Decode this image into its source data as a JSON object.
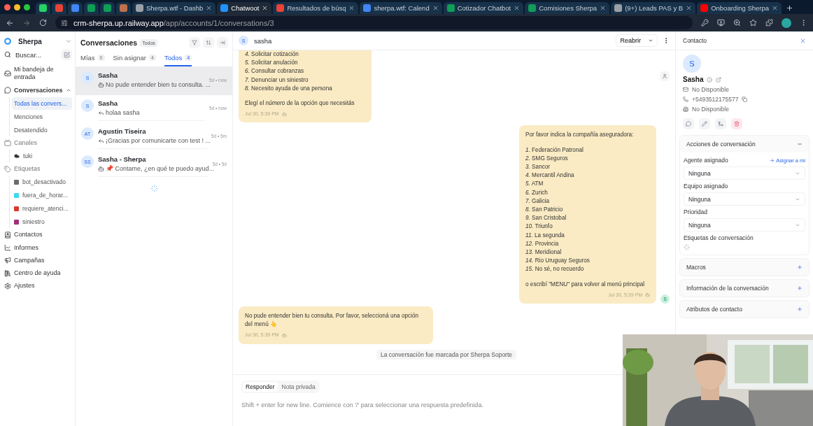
{
  "browser": {
    "tabs": [
      {
        "kind": "pinned",
        "color": "#25d366",
        "selected": false
      },
      {
        "kind": "pinned",
        "color": "#ea4335",
        "selected": false
      },
      {
        "kind": "pinned",
        "color": "#4285f4",
        "selected": false
      },
      {
        "kind": "pinned",
        "color": "#0f9d58",
        "selected": false
      },
      {
        "kind": "pinned",
        "color": "#0f9d58",
        "selected": false
      },
      {
        "kind": "pinned",
        "color": "#c0704a",
        "selected": false
      },
      {
        "kind": "titled",
        "color": "#9aa0a6",
        "label": "Sherpa.wtf - Dashb",
        "selected": false
      },
      {
        "kind": "titled",
        "color": "#1f93ff",
        "label": "Chatwoot",
        "selected": true
      },
      {
        "kind": "titled",
        "color": "#ea4335",
        "label": "Resultados de búsq",
        "selected": false
      },
      {
        "kind": "titled",
        "color": "#4285f4",
        "label": "sherpa.wtf: Calend",
        "selected": false
      },
      {
        "kind": "titled",
        "color": "#0f9d58",
        "label": "Cotizador Chatbot",
        "selected": false
      },
      {
        "kind": "titled",
        "color": "#0f9d58",
        "label": "Comisiones Sherpa",
        "selected": false
      },
      {
        "kind": "titled",
        "color": "#9aa0a6",
        "label": "(9+) Leads PAS y B",
        "selected": false
      },
      {
        "kind": "titled",
        "color": "#ff0000",
        "label": "Onboarding Sherpa",
        "selected": false
      }
    ],
    "url": "**crm-sherpa.up.railway.app**/app/accounts/1/conversations/3"
  },
  "sidebar": {
    "account": "Sherpa",
    "search": {
      "placeholder": "Buscar..."
    },
    "items": [
      {
        "kind": "inbox",
        "label": "Mi bandeja de entrada"
      },
      {
        "kind": "conversations",
        "label": "Conversaciones",
        "expanded": true,
        "children": [
          {
            "label": "Todas las convers...",
            "selected": true
          },
          {
            "label": "Menciones",
            "selected": false
          },
          {
            "label": "Desatendido",
            "selected": false
          }
        ]
      },
      {
        "kind": "channels",
        "label": "Canales",
        "children": [
          {
            "label": "tuki",
            "kind": "channel"
          }
        ]
      },
      {
        "kind": "labels",
        "label": "Etiquetas",
        "children": [
          {
            "label": "bot_desactivado",
            "color": "#6b6b6b"
          },
          {
            "label": "fuera_de_horar...",
            "color": "#3ed8f0"
          },
          {
            "label": "requiere_atenci...",
            "color": "#d93a2b"
          },
          {
            "label": "siniestro",
            "color": "#a0307a"
          }
        ]
      },
      {
        "kind": "contacts",
        "label": "Contactos"
      },
      {
        "kind": "reports",
        "label": "Informes"
      },
      {
        "kind": "campaigns",
        "label": "Campañas"
      },
      {
        "kind": "help",
        "label": "Centro de ayuda"
      },
      {
        "kind": "settings",
        "label": "Ajustes"
      }
    ]
  },
  "conversations": {
    "title": "Conversaciones",
    "filter": "Todos",
    "tabs": [
      {
        "label": "Mías",
        "count": "0",
        "selected": false
      },
      {
        "label": "Sin asignar",
        "count": "4",
        "selected": false
      },
      {
        "label": "Todos",
        "count": "4",
        "selected": true
      }
    ],
    "items": [
      {
        "initials": "S",
        "name": "Sasha",
        "kind": "bot",
        "preview": "No pude entender bien tu consulta. ...",
        "time": "5d • now",
        "selected": true
      },
      {
        "initials": "S",
        "name": "Sasha",
        "kind": "reply",
        "preview": "holaa sasha",
        "time": "5d • now",
        "selected": false
      },
      {
        "initials": "AT",
        "name": "Agustin Tiseira",
        "kind": "reply",
        "preview": "¡Gracias por comunicarte con test ! ...",
        "time": "5d • 5m",
        "selected": false
      },
      {
        "initials": "SS",
        "name": "Sasha - Sherpa",
        "kind": "bot",
        "preview": "📌 Contame, ¿en qué te puedo ayud...",
        "time": "5d • 5d",
        "selected": false
      }
    ]
  },
  "chat": {
    "contact": {
      "initials": "S",
      "name": "sasha"
    },
    "action": "Reabrir",
    "messages": [
      {
        "kind": "incoming",
        "blocks": [
          [
            "*4.* Solicitar cotización",
            "*5.* Solicitar anulación",
            "*6.* Consultar cobranzas",
            "*7.* Denunciar un siniestro",
            "*8.* Necesito ayuda de una persona"
          ],
          [
            "Elegí el *número* de la opción que necesitás"
          ]
        ],
        "time": "Jul 30, 5:39 PM"
      },
      {
        "kind": "outgoing",
        "avatar": "S",
        "blocks": [
          [
            "Por favor indica la compañía aseguradora:"
          ],
          [
            "*1.* Federación Patronal",
            "*2.* SMG Seguros",
            "*3.* Sancor",
            "*4.* Mercantil Andina",
            "*5.* ATM",
            "*6.* Zurich",
            "*7.* Galicia",
            "*8.* San Patricio",
            "*9.* San Cristobal",
            "*10.* Triunfo",
            "*11.* La segunda",
            "*12.* Provincia",
            "*13.* Meridional",
            "*14.* Rio Uruguay Seguros",
            "*15.* No sé, no recuerdo"
          ],
          [
            "o escribí \"MENU\" para volver al menú principal"
          ]
        ],
        "time": "Jul 30, 5:39 PM"
      },
      {
        "kind": "incoming",
        "blocks": [
          [
            "No pude entender bien tu consulta. Por favor, seleccioná una opción del menú 👆"
          ]
        ],
        "time": "Jul 30, 5:39 PM"
      }
    ],
    "activity": "La conversación fue marcada por Sherpa Soporte",
    "composer": {
      "tabs": [
        {
          "label": "Responder",
          "selected": true
        },
        {
          "label": "Nota privada",
          "selected": false
        }
      ],
      "placeholder": "Shift + enter for new line. Comience con '/' para seleccionar una respuesta predefinida."
    }
  },
  "contact": {
    "title": "Contacto",
    "initials": "S",
    "name": "Sasha",
    "details": [
      {
        "kind": "email",
        "text": "No Disponible"
      },
      {
        "kind": "phone",
        "text": "+5493512175577"
      },
      {
        "kind": "company",
        "text": "No Disponible"
      }
    ],
    "sections": [
      {
        "title": "Acciones de conversación",
        "expanded": true,
        "fields": [
          {
            "label": "Agente asignado",
            "action": "Asignar a mi",
            "value": "Ninguna"
          },
          {
            "label": "Equipo asignado",
            "value": "Ninguna"
          },
          {
            "label": "Prioridad",
            "value": "Ninguna"
          },
          {
            "label": "Etiquetas de conversación",
            "kind": "loading"
          }
        ]
      },
      {
        "title": "Macros",
        "expanded": false
      },
      {
        "title": "Información de la conversación",
        "expanded": false
      },
      {
        "title": "Atributos de contacto",
        "expanded": false
      }
    ]
  }
}
